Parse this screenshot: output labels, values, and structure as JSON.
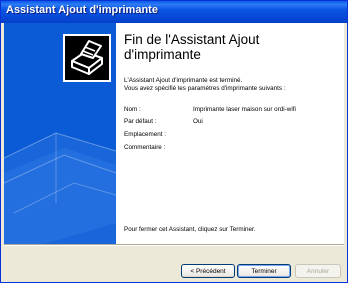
{
  "window": {
    "title": "Assistant Ajout d'imprimante"
  },
  "main": {
    "heading": "Fin de l'Assistant Ajout d'imprimante",
    "intro_line1": "L'Assistant Ajout d'imprimante est terminé.",
    "intro_line2": "Vous avez spécifié les paramètres d'imprimante suivants :",
    "settings": [
      {
        "label": "Nom :",
        "value": "Imprimante laser maison sur ordi-wifi"
      },
      {
        "label": "Par défaut :",
        "value": "Oui"
      },
      {
        "label": "Emplacement :",
        "value": ""
      },
      {
        "label": "Commentaire :",
        "value": ""
      }
    ],
    "closing": "Pour fermer cet Assistant, cliquez sur Terminer."
  },
  "buttons": {
    "back": "< Précédent",
    "finish": "Terminer",
    "cancel": "Annuler"
  },
  "icons": {
    "wizard": "printer-icon"
  },
  "colors": {
    "sidebar": "#0a5bd5",
    "titlebar": "#0a5ae6"
  }
}
